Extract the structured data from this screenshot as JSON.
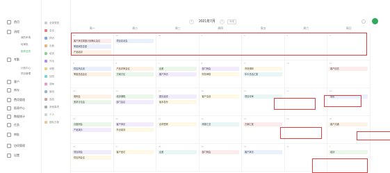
{
  "sidebar": {
    "items": [
      {
        "label": "首页",
        "icon": "home-icon"
      },
      {
        "label": "流程",
        "icon": "flow-icon"
      },
      {
        "label": "考勤",
        "icon": "clock-icon"
      },
      {
        "label": "客户",
        "icon": "customer-icon"
      },
      {
        "label": "库存",
        "icon": "stock-icon"
      },
      {
        "label": "费用管理",
        "icon": "fee-icon"
      },
      {
        "label": "报表中心",
        "icon": "report-icon"
      },
      {
        "label": "数据统计",
        "icon": "data-icon"
      },
      {
        "label": "任务",
        "icon": "task-icon"
      },
      {
        "label": "审批",
        "icon": "approve-icon"
      },
      {
        "label": "协同管理",
        "icon": "collab-icon"
      },
      {
        "label": "设置",
        "icon": "settings-icon"
      }
    ],
    "subs": [
      "我的申请",
      "待审批",
      "协作日历",
      "计划中心",
      "项目管理"
    ],
    "active_sub": "协作日历"
  },
  "filters": [
    {
      "label": "全部类型",
      "color": "#cccccc"
    },
    {
      "label": "会议",
      "color": "#e87b7b"
    },
    {
      "label": "拜访",
      "color": "#7ba7e8"
    },
    {
      "label": "出差",
      "color": "#e8b77b"
    },
    {
      "label": "培训",
      "color": "#8ed18e"
    },
    {
      "label": "外出",
      "color": "#b08ee8"
    },
    {
      "label": "请假",
      "color": "#e8d27b"
    },
    {
      "label": "加班",
      "color": "#7bd6d1"
    },
    {
      "label": "调休",
      "color": "#e89ac9"
    },
    {
      "label": "值班",
      "color": "#9ab0c9"
    },
    {
      "label": "巡检",
      "color": "#c9a39a"
    },
    {
      "label": "其他事项",
      "color": "#aaaaaa"
    },
    {
      "label": "个人",
      "color": "#d4d4d4"
    },
    {
      "label": "团队日程",
      "color": "#f0c39a"
    }
  ],
  "toolbar": {
    "prev": "‹",
    "next": "›",
    "date": "2021年7月",
    "today": "今天",
    "add": "+"
  },
  "weekdays": [
    "周一",
    "周二",
    "周三",
    "周四",
    "周五",
    "周六",
    "周日"
  ],
  "weeks": [
    {
      "days": [
        "28",
        "29",
        "30",
        "1",
        "2",
        "3",
        "4"
      ],
      "events": [
        [
          "客户拜访周度计划确认会议",
          "项目启动会",
          "",
          "",
          "",
          "",
          ""
        ],
        [
          "季度销售复盘",
          "",
          "",
          "",
          "",
          "",
          ""
        ],
        [
          "产品培训",
          "",
          "",
          "",
          "",
          "",
          ""
        ]
      ]
    },
    {
      "days": [
        "5",
        "6",
        "7",
        "8",
        "9",
        "10",
        "11"
      ],
      "events": [
        [
          "供应商洽谈",
          "产品评审会议",
          "出差",
          "部门例会",
          "市场调研",
          "",
          "客户回访"
        ],
        [
          "季度总结会议",
          "方案讨论",
          "客户拜访",
          "财务审核",
          "年中总结汇报",
          "",
          ""
        ]
      ]
    },
    {
      "days": [
        "12",
        "13",
        "14",
        "15",
        "16",
        "17",
        "18"
      ],
      "events": [
        [
          "周例会",
          "培训课程",
          "团队建设",
          "客户洽谈",
          "项目评审",
          "",
          "值班"
        ],
        [
          "需求讨论会",
          "部门会议",
          "版本发布",
          "",
          "",
          "",
          ""
        ]
      ]
    },
    {
      "days": [
        "19",
        "20",
        "21",
        "22",
        "23",
        "24",
        "25"
      ],
      "events": [
        [
          "月度例会",
          "客户拜访",
          "合同签署",
          "周报汇总",
          "方案汇报",
          "",
          "客户沟通"
        ],
        [
          "产品演示",
          "外出培训",
          "",
          "",
          "",
          "",
          ""
        ]
      ]
    },
    {
      "days": [
        "26",
        "27",
        "28",
        "29",
        "30",
        "31",
        "1"
      ],
      "events": [
        [
          "项目周会",
          "客户回访",
          "出差",
          "部门例会",
          "客户拜访",
          "",
          "培训"
        ],
        [
          "供应商会议",
          "",
          "",
          "",
          "",
          "",
          ""
        ]
      ]
    }
  ]
}
